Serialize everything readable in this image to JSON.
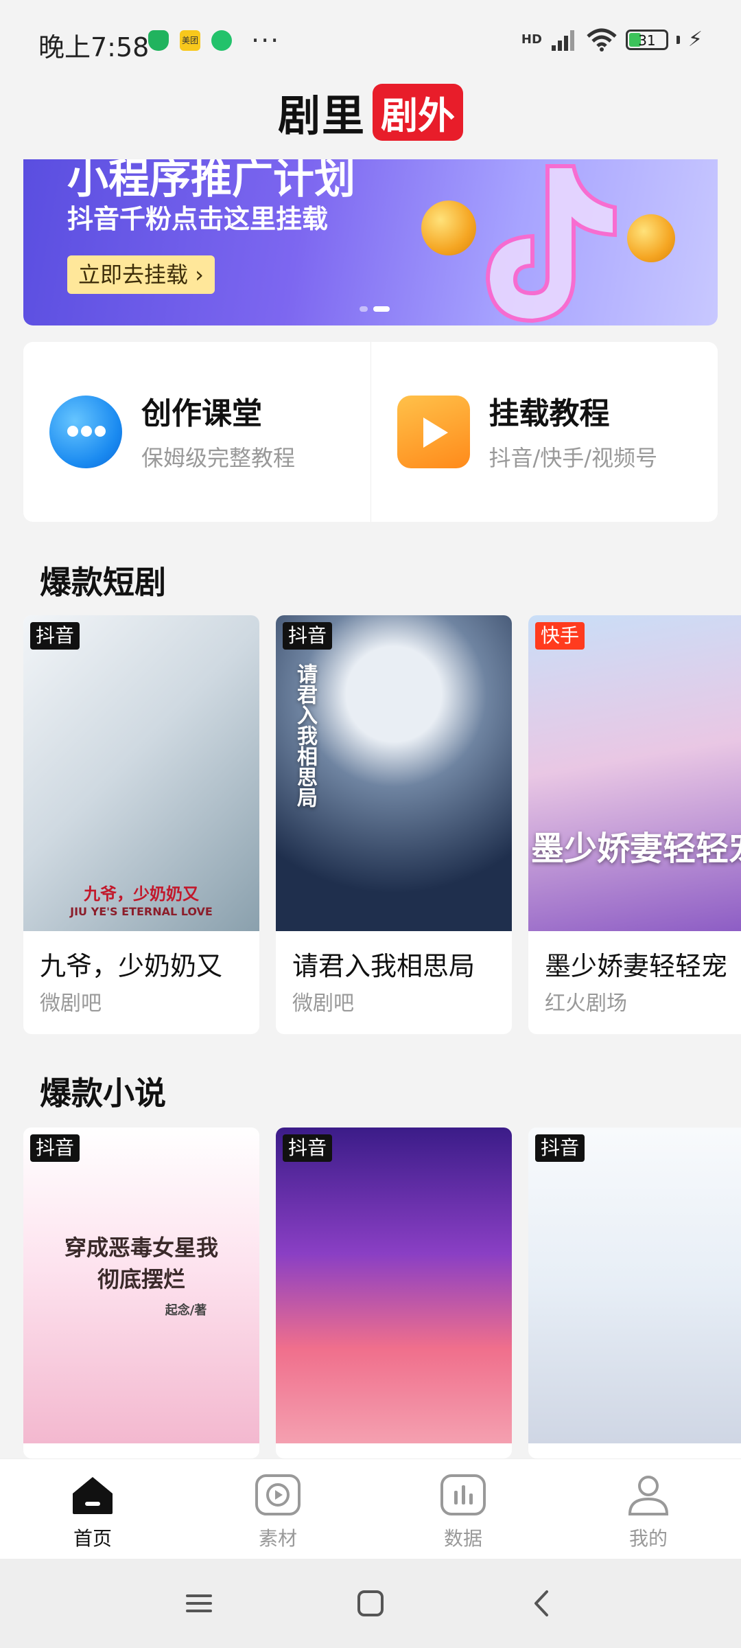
{
  "status_bar": {
    "time": "晚上7:58",
    "hd_label": "HD",
    "battery_level": "31",
    "notification_icons": [
      "shield-icon",
      "meituan-icon",
      "green-app-icon"
    ],
    "meituan_text": "美团",
    "more_dots": "···"
  },
  "header": {
    "logo_main": "剧里",
    "logo_badge": "剧外"
  },
  "banner": {
    "headline": "小程序推广计划",
    "subtitle": "抖音千粉点击这里挂载",
    "button_label": "立即去挂载 ›",
    "slide_index": 2,
    "slide_count": 2
  },
  "features": [
    {
      "title": "创作课堂",
      "subtitle": "保姆级完整教程",
      "icon": "chat-bubble-icon"
    },
    {
      "title": "挂载教程",
      "subtitle": "抖音/快手/视频号",
      "icon": "tv-play-icon"
    }
  ],
  "sections": {
    "dramas": {
      "title": "爆款短剧",
      "items": [
        {
          "tag": "抖音",
          "title": "九爷，少奶奶又",
          "source": "微剧吧",
          "cover_text": "九爷，少奶奶又",
          "cover_sub": "JIU YE'S ETERNAL LOVE"
        },
        {
          "tag": "抖音",
          "title": "请君入我相思局",
          "source": "微剧吧",
          "cover_text": "请君入我相思局"
        },
        {
          "tag": "快手",
          "title": "墨少娇妻轻轻宠",
          "source": "红火剧场",
          "cover_text": "墨少娇妻轻轻宠"
        }
      ]
    },
    "novels": {
      "title": "爆款小说",
      "items": [
        {
          "tag": "抖音",
          "cover_text": "穿成恶毒女星我彻底摆烂",
          "cover_sub": "起念/著"
        },
        {
          "tag": "抖音"
        },
        {
          "tag": "抖音"
        }
      ]
    }
  },
  "bottom_nav": [
    {
      "label": "首页",
      "icon": "home-icon",
      "active": true
    },
    {
      "label": "素材",
      "icon": "play-square-icon",
      "active": false
    },
    {
      "label": "数据",
      "icon": "bar-chart-icon",
      "active": false
    },
    {
      "label": "我的",
      "icon": "user-icon",
      "active": false
    }
  ],
  "colors": {
    "accent_red": "#e81d2a",
    "tag_black": "#111111",
    "tag_red": "#ff3b1e",
    "banner_purple": "#6b5ae8",
    "background": "#f3f3f3"
  }
}
